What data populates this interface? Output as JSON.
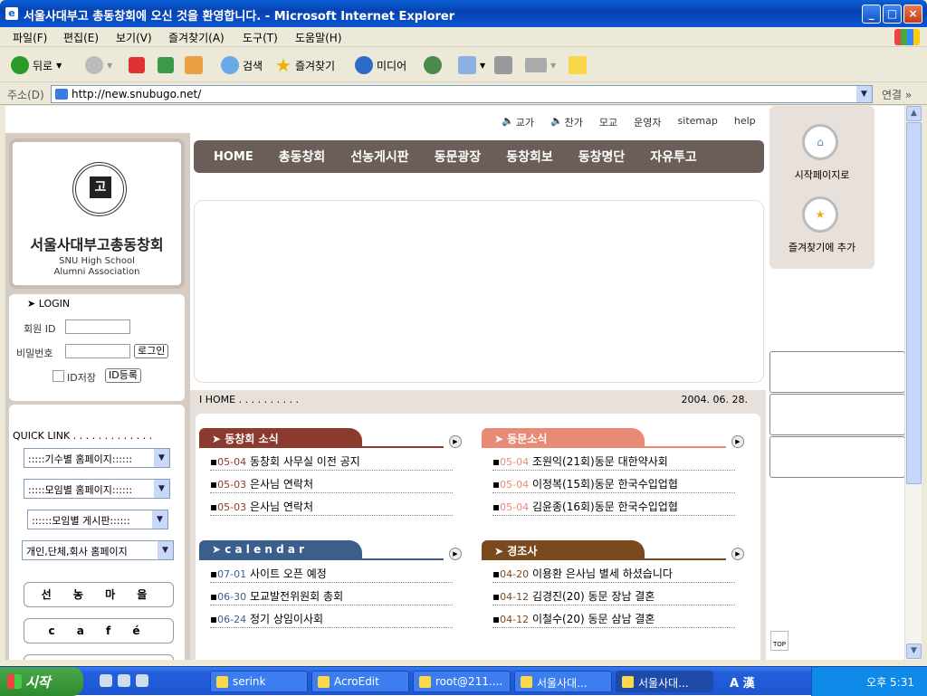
{
  "window": {
    "title": "서울사대부고 총동창회에 오신 것을 환영합니다. - Microsoft Internet Explorer"
  },
  "menu": [
    "파일(F)",
    "편집(E)",
    "보기(V)",
    "즐겨찾기(A)",
    "도구(T)",
    "도움말(H)"
  ],
  "toolbar": {
    "back": "뒤로",
    "search": "검색",
    "favorites": "즐겨찾기",
    "media": "미디어"
  },
  "address": {
    "label": "주소(D)",
    "url": "http://new.snubugo.net/",
    "go": "연결"
  },
  "site": {
    "topnav": [
      "교가",
      "찬가",
      "모교",
      "운영자",
      "sitemap",
      "help"
    ],
    "logo_ko": "서울사대부고총동창회",
    "logo_en1": "SNU High School",
    "logo_en2": "Alumni Association",
    "login": {
      "header": "LOGIN",
      "id_label": "회원 ID",
      "pw_label": "비밀번호",
      "login_btn": "로그인",
      "save_id": "ID저장",
      "register": "ID등록"
    },
    "quick": {
      "header": "QUICK LINK . . . . . . . . . . . . .",
      "selects": [
        ":::::기수별 홈페이지::::::",
        ":::::모임별 홈페이지::::::",
        "::::::모임별  게시판::::::",
        "개인,단체,회사 홈페이지"
      ],
      "buttons": [
        "선 농 마 을",
        "c a f é"
      ]
    },
    "mainnav": [
      "HOME",
      "총동창회",
      "선농게시판",
      "동문광장",
      "동창회보",
      "동창명단",
      "자유투고"
    ],
    "crumb": "HOME . . . . . . . . . .",
    "date": "2004. 06. 28.",
    "right": {
      "start": "시작페이지로",
      "fav": "즐겨찾기에 추가",
      "top": "TOP"
    },
    "sections": [
      {
        "title": "동창회 소식",
        "color": "#8c3a2e",
        "items": [
          {
            "date": "05-04",
            "text": "동창회 사무실 이전 공지"
          },
          {
            "date": "05-03",
            "text": "은사님 연락처"
          },
          {
            "date": "05-03",
            "text": "은사님 연락처"
          }
        ]
      },
      {
        "title": "동문소식",
        "color": "#e88a76",
        "items": [
          {
            "date": "05-04",
            "text": "조원익(21회)동문 대한약사회"
          },
          {
            "date": "05-04",
            "text": "이정복(15회)동문 한국수입업협"
          },
          {
            "date": "05-04",
            "text": "김윤종(16회)동문 한국수입업협"
          }
        ]
      },
      {
        "title": "c a l e n d a r",
        "color": "#3a5f8c",
        "items": [
          {
            "date": "07-01",
            "text": "사이트 오픈 예정"
          },
          {
            "date": "06-30",
            "text": "모교발전위원회 총회"
          },
          {
            "date": "06-24",
            "text": "정기 상임이사회"
          }
        ]
      },
      {
        "title": "경조사",
        "color": "#7a4a1e",
        "items": [
          {
            "date": "04-20",
            "text": "이용환 은사님 별세 하셨습니다"
          },
          {
            "date": "04-12",
            "text": "김경진(20) 동문 장남 결혼"
          },
          {
            "date": "04-12",
            "text": "이철수(20) 동문 삼남 결혼"
          }
        ]
      }
    ]
  },
  "taskbar": {
    "start": "시작",
    "tasks": [
      "serink",
      "AcroEdit",
      "root@211....",
      "서울사대...",
      "서울사대..."
    ],
    "lang": "A 漢",
    "clock": "오후 5:31"
  }
}
